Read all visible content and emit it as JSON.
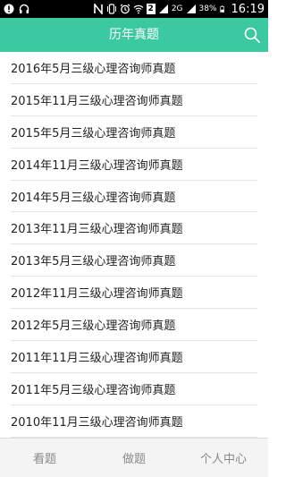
{
  "status_bar": {
    "battery": "38%",
    "sim_label": "2",
    "network": "2G",
    "time": "16:19"
  },
  "header": {
    "title": "历年真题",
    "search_icon": "search-icon",
    "color": "#3cc8a0"
  },
  "list": {
    "items": [
      "2016年5月三级心理咨询师真题",
      "2015年11月三级心理咨询师真题",
      "2015年5月三级心理咨询师真题",
      "2014年11月三级心理咨询师真题",
      "2014年5月三级心理咨询师真题",
      "2013年11月三级心理咨询师真题",
      "2013年5月三级心理咨询师真题",
      "2012年11月三级心理咨询师真题",
      "2012年5月三级心理咨询师真题",
      "2011年11月三级心理咨询师真题",
      "2011年5月三级心理咨询师真题",
      "2010年11月三级心理咨询师真题"
    ]
  },
  "bottom_nav": {
    "tabs": [
      "看题",
      "做题",
      "个人中心"
    ]
  }
}
